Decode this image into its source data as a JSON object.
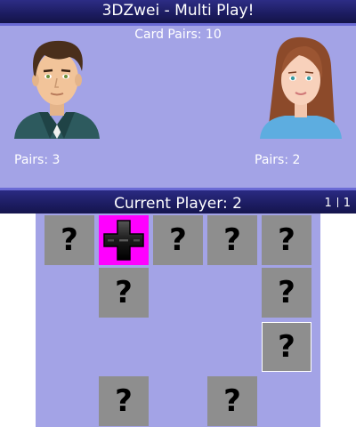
{
  "title": "3DZwei - Multi Play!",
  "card_pairs_label": "Card Pairs: 10",
  "players": [
    {
      "pairs_label": "Pairs: 3",
      "avatar": "male-avatar"
    },
    {
      "pairs_label": "Pairs: 2",
      "avatar": "female-avatar"
    }
  ],
  "current_player_label": "Current Player: 2",
  "page_indicator": {
    "current": "1",
    "total": "1"
  },
  "board": {
    "hidden_symbol": "?",
    "revealed_card_icon": "dpad-icon",
    "revealed_card_color": "#ff00ff",
    "cards": [
      {
        "state": "hidden"
      },
      {
        "state": "revealed",
        "icon": "dpad-icon"
      },
      {
        "state": "hidden"
      },
      {
        "state": "hidden"
      },
      {
        "state": "hidden"
      },
      {
        "state": "hidden"
      },
      {
        "state": "hidden"
      },
      {
        "state": "hidden",
        "selected": true
      },
      {
        "state": "hidden"
      },
      {
        "state": "hidden"
      }
    ]
  },
  "colors": {
    "background": "#a3a3e6",
    "bar": "#1c1c60",
    "card": "#8e8e8e"
  }
}
